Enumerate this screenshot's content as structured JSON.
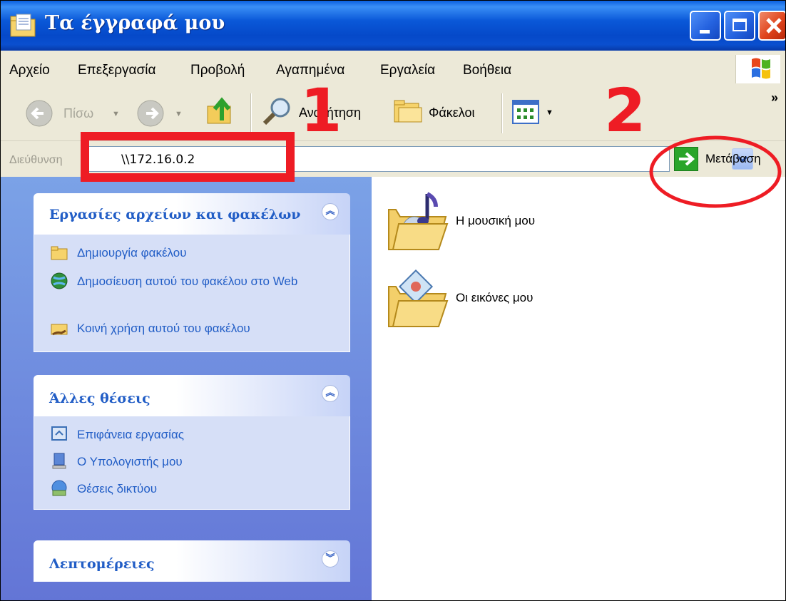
{
  "window": {
    "title": "Τα έγγραφά μου"
  },
  "menu": {
    "items": [
      "Αρχείο",
      "Επεξεργασία",
      "Προβολή",
      "Αγαπημένα",
      "Εργαλεία",
      "Βοήθεια"
    ]
  },
  "toolbar": {
    "back_label": "Πίσω",
    "search_label": "Αναζήτηση",
    "folders_label": "Φάκελοι",
    "overflow_glyph": "»"
  },
  "address": {
    "label": "Διεύθυνση",
    "value": "\\\\172.16.0.2",
    "go_label": "Μετάβαση"
  },
  "taskpane": {
    "file_tasks": {
      "title": "Εργασίες αρχείων και φακέλων",
      "items": [
        {
          "label": "Δημιουργία φακέλου"
        },
        {
          "label": "Δημοσίευση αυτού του φακέλου στο Web"
        },
        {
          "label": "Κοινή χρήση αυτού του φακέλου"
        }
      ]
    },
    "other_places": {
      "title": "Άλλες θέσεις",
      "items": [
        {
          "label": "Επιφάνεια εργασίας"
        },
        {
          "label": "Ο Υπολογιστής μου"
        },
        {
          "label": "Θέσεις δικτύου"
        }
      ]
    },
    "details": {
      "title": "Λεπτομέρειες"
    },
    "collapse_glyph": "︽",
    "expand_glyph": "︾"
  },
  "content": {
    "folders": [
      {
        "label": "Η μουσική μου",
        "icon": "music-folder-icon"
      },
      {
        "label": "Οι εικόνες μου",
        "icon": "pictures-folder-icon"
      }
    ]
  },
  "annotations": {
    "step_1": "1",
    "step_2": "2",
    "color": "#ee1c24"
  }
}
